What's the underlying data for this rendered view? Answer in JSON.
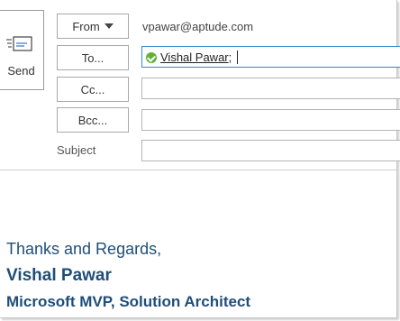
{
  "compose": {
    "send_label": "Send",
    "from_label": "From",
    "from_value": "vpawar@aptude.com",
    "to_label": "To...",
    "cc_label": "Cc...",
    "bcc_label": "Bcc...",
    "subject_label": "Subject",
    "to_recipient": "Vishal Pawar",
    "to_separator": ";"
  },
  "signature": {
    "thanks": "Thanks and Regards,",
    "name": "Vishal Pawar",
    "title": "Microsoft MVP, Solution Architect"
  },
  "colors": {
    "signature": "#1f4e79",
    "active_field_border": "#2a8bd2",
    "resolved_check": "#5fb336"
  }
}
